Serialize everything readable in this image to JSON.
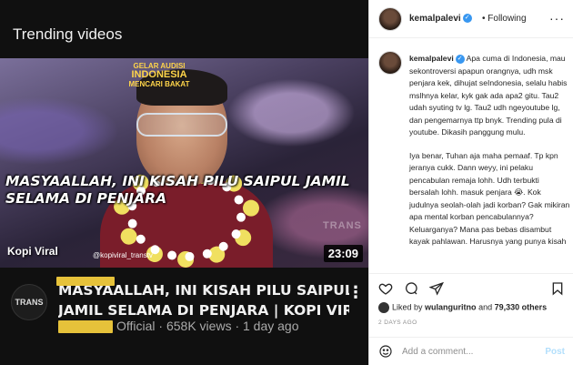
{
  "youtube": {
    "section_title": "Trending videos",
    "thumbnail": {
      "brand_line1": "GELAR AUDISI",
      "brand_line2": "INDONESIA",
      "brand_line3": "MENCARI BAKAT",
      "headline": "MASYAALLAH, INI KISAH PILU SAIPUL JAMIL SELAMA DI PENJARA",
      "corner_logo": "Kopi Viral",
      "handle": "@kopiviral_transtv",
      "tv_logo": "TRANS",
      "duration": "23:09"
    },
    "channel_avatar_text": "TRANS",
    "video_title_line1": "MASYAALLAH, INI KISAH PILU SAIPUL",
    "video_title_line2": "JAMIL SELAMA DI PENJARA | KOPI VIR...",
    "meta": "Official · 658K views · 1 day ago",
    "more_icon": "vertical-dots-icon"
  },
  "instagram": {
    "username": "kemalpalevi",
    "follow_status": "Following",
    "caption_username": "kemalpalevi",
    "caption_p1": "Apa cuma di Indonesia, mau sekontroversi apapun orangnya, udh msk penjara kek, dihujat seIndonesia, selalu habis mslhnya kelar, kyk gak ada apa2 gitu. Tau2 udah syuting tv lg. Tau2 udh ngeyoutube lg, dan pengemarnya ttp bnyk. Trending pula di youtube. Dikasih panggung mulu.",
    "caption_p2": "Iya benar, Tuhan aja maha pemaaf. Tp kpn jeranya cukk. Dann weyy, ini pelaku pencabulan remaja lohh. Udh terbukti bersalah lohh. masuk penjara 😭. Kok judulnya seolah-olah jadi korban? Gak mikiran apa mental korban pencabulannya? Keluarganya? Mana pas bebas disambut kayak pahlawan. Harusnya yang punya kisah",
    "likes_prefix": "Liked by",
    "likes_user": "wulanguritno",
    "likes_and": "and",
    "likes_count": "79,330 others",
    "time_ago": "2 DAYS AGO",
    "comment_placeholder": "Add a comment...",
    "post_label": "Post",
    "colors": {
      "verified": "#3897f0",
      "post": "#b2dffc"
    }
  }
}
